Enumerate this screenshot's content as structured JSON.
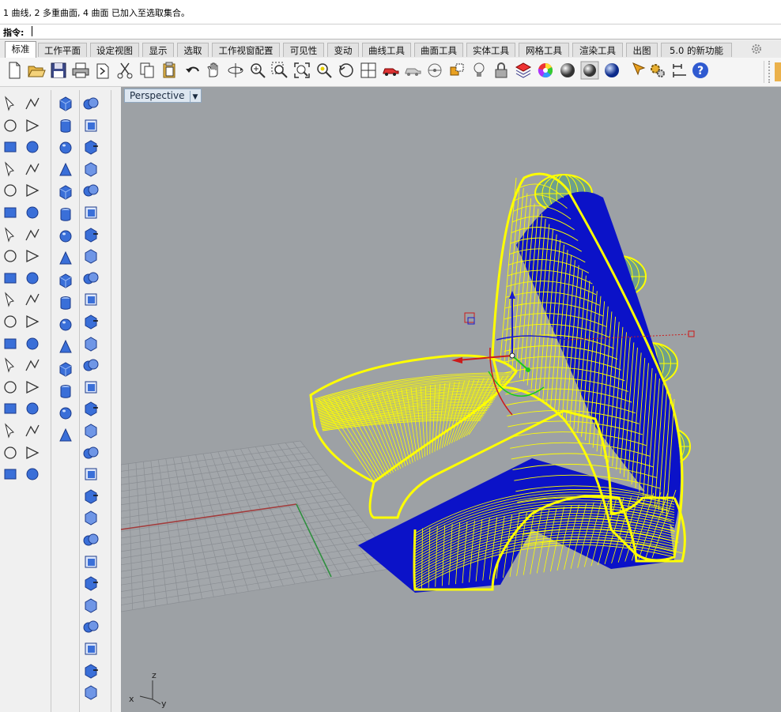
{
  "command": {
    "history": "1 曲线, 2 多重曲面, 4 曲面 已加入至选取集合。",
    "prompt": "指令:"
  },
  "tabs": [
    "标准",
    "工作平面",
    "设定视图",
    "显示",
    "选取",
    "工作视窗配置",
    "可见性",
    "变动",
    "曲线工具",
    "曲面工具",
    "实体工具",
    "网格工具",
    "渲染工具",
    "出图",
    "5.0 的新功能"
  ],
  "active_tab": "标准",
  "viewport": {
    "name": "Perspective",
    "axis_labels": {
      "z": "z",
      "x": "x",
      "y": "y"
    }
  },
  "colors": {
    "selection": "#ffff00",
    "surface_fill": "#0b12c8",
    "viewport_bg": "#9da1a5",
    "grid": "#8a8e93",
    "x_axis": "#a23b3b",
    "y_axis": "#2f8f3f",
    "ellipsoid": "#6fa08c"
  }
}
